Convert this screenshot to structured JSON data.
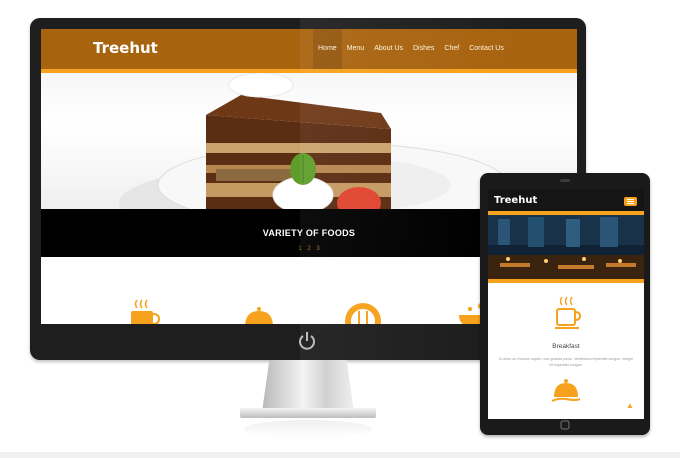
{
  "desktop": {
    "brand": "Treehut",
    "nav": [
      {
        "label": "Home",
        "active": true
      },
      {
        "label": "Menu",
        "active": false
      },
      {
        "label": "About Us",
        "active": false
      },
      {
        "label": "Dishes",
        "active": false
      },
      {
        "label": "Chef",
        "active": false
      },
      {
        "label": "Contact Us",
        "active": false
      }
    ],
    "slide_caption": "VARIETY OF FOODS",
    "pager": [
      "1",
      "2",
      "3"
    ],
    "feature_icons": [
      "coffee-cup-icon",
      "food-cloche-icon",
      "plate-cutlery-icon",
      "salad-bowl-icon"
    ]
  },
  "tablet": {
    "brand": "Treehut",
    "menu_icon": "hamburger-menu-icon",
    "section_title": "Breakfast",
    "section_text": "To dolor ac rhoncus sapien, con gravida purus. Vestibulum imperdiet congue. Integer sit imperdiet congue.",
    "icons": [
      "coffee-cup-icon",
      "food-cloche-icon",
      "chevron-up-icon"
    ]
  },
  "colors": {
    "header_brown": "#a8630f",
    "accent_orange": "#f6a21c",
    "device_black": "#1e1e1e"
  }
}
